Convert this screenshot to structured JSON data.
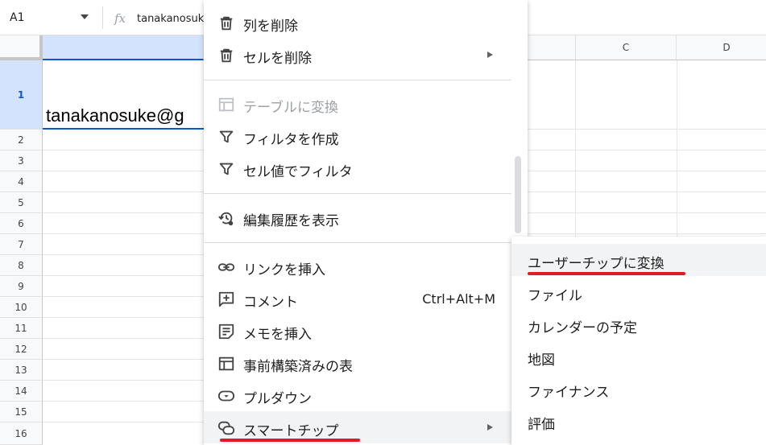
{
  "formula_bar": {
    "cell_ref": "A1",
    "fx_label": "fx",
    "formula_text": "tanakanosuke@g"
  },
  "grid": {
    "columns": [
      "",
      "C",
      "D"
    ],
    "rows": [
      "1",
      "2",
      "3",
      "4",
      "5",
      "6",
      "7",
      "8",
      "9",
      "10",
      "11",
      "12",
      "13",
      "14",
      "15",
      "16"
    ],
    "cell_a1": "tanakanosuke@g"
  },
  "context_menu": {
    "items": [
      {
        "label": "列を削除",
        "icon": "trash-icon"
      },
      {
        "label": "セルを削除",
        "icon": "trash-icon",
        "submenu": true
      },
      {
        "label": "テーブルに変換",
        "icon": "table-icon",
        "disabled": true
      },
      {
        "label": "フィルタを作成",
        "icon": "filter-icon"
      },
      {
        "label": "セル値でフィルタ",
        "icon": "filter-icon"
      },
      {
        "label": "編集履歴を表示",
        "icon": "history-icon"
      },
      {
        "label": "リンクを挿入",
        "icon": "link-icon"
      },
      {
        "label": "コメント",
        "icon": "comment-icon",
        "shortcut": "Ctrl+Alt+M"
      },
      {
        "label": "メモを挿入",
        "icon": "note-icon"
      },
      {
        "label": "事前構築済みの表",
        "icon": "table-icon"
      },
      {
        "label": "プルダウン",
        "icon": "dropdown-icon"
      },
      {
        "label": "スマートチップ",
        "icon": "smart-chip-icon",
        "submenu": true,
        "highlighted": true
      }
    ]
  },
  "submenu": {
    "items": [
      {
        "label": "ユーザーチップに変換",
        "highlighted": true
      },
      {
        "label": "ファイル"
      },
      {
        "label": "カレンダーの予定"
      },
      {
        "label": "地図"
      },
      {
        "label": "ファイナンス"
      },
      {
        "label": "評価"
      }
    ]
  },
  "colors": {
    "accent_blue": "#0b57d0",
    "selection_bg": "#d3e3fd",
    "annotation_red": "#e01b24"
  }
}
